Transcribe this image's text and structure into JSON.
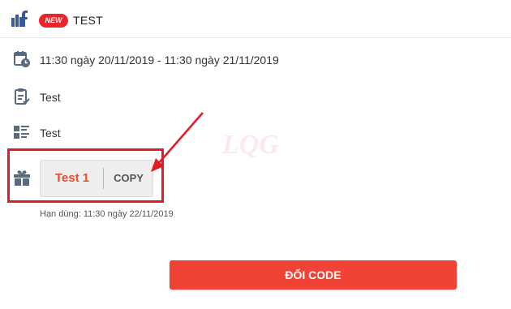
{
  "header": {
    "badge": "NEW",
    "title": "TEST"
  },
  "event": {
    "time_range": "11:30 ngày 20/11/2019 - 11:30 ngày 21/11/2019",
    "rules_text": "Test",
    "description_text": "Test"
  },
  "voucher": {
    "code": "Test 1",
    "copy_label": "COPY",
    "expiry": "Hạn dùng: 11:30 ngày 22/11/2019"
  },
  "actions": {
    "redeem_label": "ĐỔI CODE"
  },
  "watermark": {
    "text": "LQG"
  },
  "colors": {
    "accent": "#f04336",
    "code_text": "#ea4c2c",
    "badge": "#e8262b",
    "icon": "#5a6a7e",
    "annotation": "#e31b23"
  }
}
